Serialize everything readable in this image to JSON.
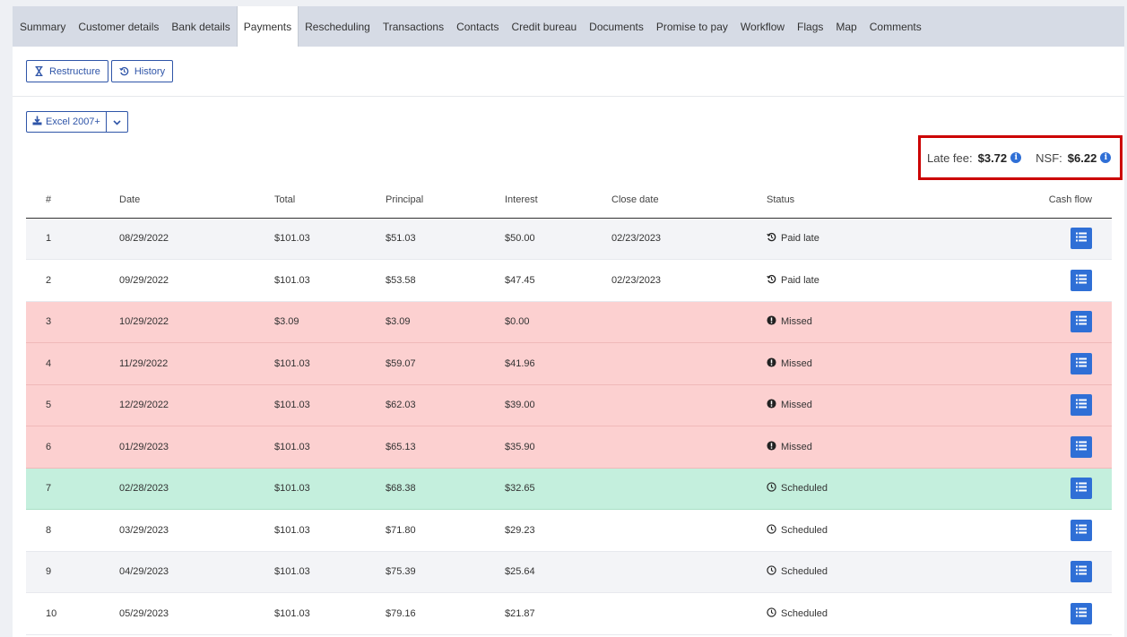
{
  "tabs": [
    {
      "label": "Summary",
      "active": false
    },
    {
      "label": "Customer details",
      "active": false
    },
    {
      "label": "Bank details",
      "active": false
    },
    {
      "label": "Payments",
      "active": true
    },
    {
      "label": "Rescheduling",
      "active": false
    },
    {
      "label": "Transactions",
      "active": false
    },
    {
      "label": "Contacts",
      "active": false
    },
    {
      "label": "Credit bureau",
      "active": false
    },
    {
      "label": "Documents",
      "active": false
    },
    {
      "label": "Promise to pay",
      "active": false
    },
    {
      "label": "Workflow",
      "active": false
    },
    {
      "label": "Flags",
      "active": false
    },
    {
      "label": "Map",
      "active": false
    },
    {
      "label": "Comments",
      "active": false
    }
  ],
  "toolbar": {
    "restructure_label": "Restructure",
    "history_label": "History"
  },
  "export": {
    "label": "Excel 2007+"
  },
  "fees": {
    "late_fee_label": "Late fee:",
    "late_fee_value": "$3.72",
    "nsf_label": "NSF:",
    "nsf_value": "$6.22"
  },
  "table": {
    "headers": {
      "num": "#",
      "date": "Date",
      "total": "Total",
      "principal": "Principal",
      "interest": "Interest",
      "close_date": "Close date",
      "status": "Status",
      "cash_flow": "Cash flow"
    },
    "rows": [
      {
        "num": "1",
        "date": "08/29/2022",
        "total": "$101.03",
        "principal": "$51.03",
        "interest": "$50.00",
        "close_date": "02/23/2023",
        "status": "Paid late",
        "kind": "paid"
      },
      {
        "num": "2",
        "date": "09/29/2022",
        "total": "$101.03",
        "principal": "$53.58",
        "interest": "$47.45",
        "close_date": "02/23/2023",
        "status": "Paid late",
        "kind": "paid"
      },
      {
        "num": "3",
        "date": "10/29/2022",
        "total": "$3.09",
        "principal": "$3.09",
        "interest": "$0.00",
        "close_date": "",
        "status": "Missed",
        "kind": "missed"
      },
      {
        "num": "4",
        "date": "11/29/2022",
        "total": "$101.03",
        "principal": "$59.07",
        "interest": "$41.96",
        "close_date": "",
        "status": "Missed",
        "kind": "missed"
      },
      {
        "num": "5",
        "date": "12/29/2022",
        "total": "$101.03",
        "principal": "$62.03",
        "interest": "$39.00",
        "close_date": "",
        "status": "Missed",
        "kind": "missed"
      },
      {
        "num": "6",
        "date": "01/29/2023",
        "total": "$101.03",
        "principal": "$65.13",
        "interest": "$35.90",
        "close_date": "",
        "status": "Missed",
        "kind": "missed"
      },
      {
        "num": "7",
        "date": "02/28/2023",
        "total": "$101.03",
        "principal": "$68.38",
        "interest": "$32.65",
        "close_date": "",
        "status": "Scheduled",
        "kind": "next"
      },
      {
        "num": "8",
        "date": "03/29/2023",
        "total": "$101.03",
        "principal": "$71.80",
        "interest": "$29.23",
        "close_date": "",
        "status": "Scheduled",
        "kind": "scheduled"
      },
      {
        "num": "9",
        "date": "04/29/2023",
        "total": "$101.03",
        "principal": "$75.39",
        "interest": "$25.64",
        "close_date": "",
        "status": "Scheduled",
        "kind": "scheduled"
      },
      {
        "num": "10",
        "date": "05/29/2023",
        "total": "$101.03",
        "principal": "$79.16",
        "interest": "$21.87",
        "close_date": "",
        "status": "Scheduled",
        "kind": "scheduled"
      }
    ]
  },
  "icons": {
    "restructure": "hourglass-icon",
    "history": "history-icon",
    "export": "download-icon",
    "caret": "chevron-down-icon",
    "info": "info-icon",
    "paid": "history-icon",
    "missed": "exclamation-circle-icon",
    "scheduled": "clock-icon",
    "cash_flow": "list-icon"
  },
  "colors": {
    "accent": "#2f55a8",
    "button_blue": "#2f6fd6",
    "missed_row": "#fcd0d0",
    "next_row": "#c4efdd",
    "highlight_border": "#cc0000"
  }
}
